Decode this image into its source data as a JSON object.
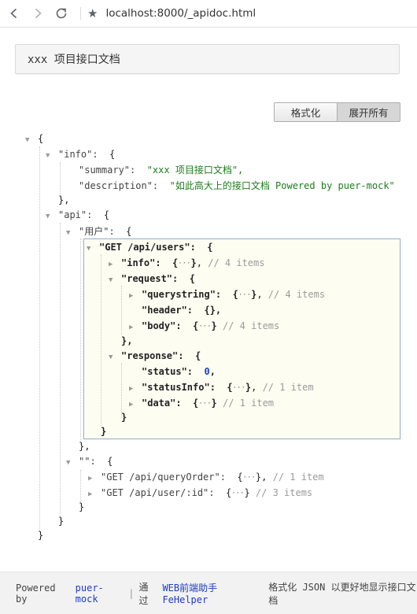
{
  "browser": {
    "url": "localhost:8000/_apidoc.html",
    "icons": [
      "back-icon",
      "forward-icon",
      "reload-icon",
      "star-icon"
    ]
  },
  "doc_title": "xxx 项目接口文档",
  "toolbar": {
    "format_label": "格式化",
    "expand_all_label": "展开所有"
  },
  "tree": {
    "root_open": "{",
    "root_close": "}",
    "info_key": "\"info\":",
    "brace_open": "{",
    "info_close": "},",
    "summary_key": "\"summary\":",
    "summary_value": "\"xxx 项目接口文档\",",
    "description_key": "\"description\":",
    "description_value": "\"如此高大上的接口文档 Powered by puer-mock\"",
    "api_key": "\"api\":",
    "api_close": "}",
    "users_group_key": "\"用户\":",
    "users_group_close": "},",
    "get_users_key": "\"GET /api/users\":",
    "get_users_close": "}",
    "g_info_key": "\"info\":",
    "g_info_comment": "// 4 items",
    "request_key": "\"request\":",
    "request_close": "},",
    "querystring_key": "\"querystring\":",
    "querystring_comment": "// 4 items",
    "header_key": "\"header\":",
    "header_value": "{},",
    "body_key": "\"body\":",
    "body_comment": "// 4 items",
    "response_key": "\"response\":",
    "response_close": "}",
    "status_key": "\"status\":",
    "status_value": "0",
    "comma": ",",
    "status_info_key": "\"statusInfo\":",
    "status_info_comment": "// 1 item",
    "data_key": "\"data\":",
    "data_comment": "// 1 item",
    "empty_group_key": "\"\":",
    "empty_group_close": "}",
    "query_order_key": "\"GET /api/queryOrder\":",
    "query_order_comment": "// 1 item",
    "user_id_key": "\"GET /api/user/:id\":",
    "user_id_comment": "// 3 items"
  },
  "footer": {
    "powered_by": "Powered by",
    "puer_mock_link": "puer-mock",
    "via": "通过",
    "fehelper_link": "WEB前端助手 FeHelper",
    "tail": "格式化 JSON 以更好地显示接口文档"
  }
}
